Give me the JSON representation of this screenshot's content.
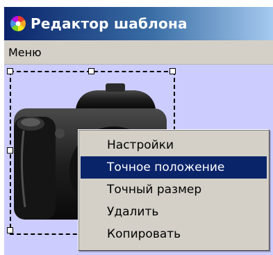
{
  "window": {
    "title": "Редактор шаблона"
  },
  "menubar": {
    "menu_label": "Меню"
  },
  "context_menu": {
    "items": [
      {
        "label": "Настройки",
        "active": false
      },
      {
        "label": "Точное положение",
        "active": true
      },
      {
        "label": "Точный размер",
        "active": false
      },
      {
        "label": "Удалить",
        "active": false
      },
      {
        "label": "Копировать",
        "active": false
      }
    ]
  },
  "colors": {
    "titlebar_start": "#0a246a",
    "titlebar_end": "#a6caf0",
    "menubar_bg": "#d4d0c8",
    "canvas_bg": "#ccccff",
    "highlight": "#0a246a"
  },
  "icons": {
    "app": "color-wheel-icon",
    "object": "camera-image"
  }
}
